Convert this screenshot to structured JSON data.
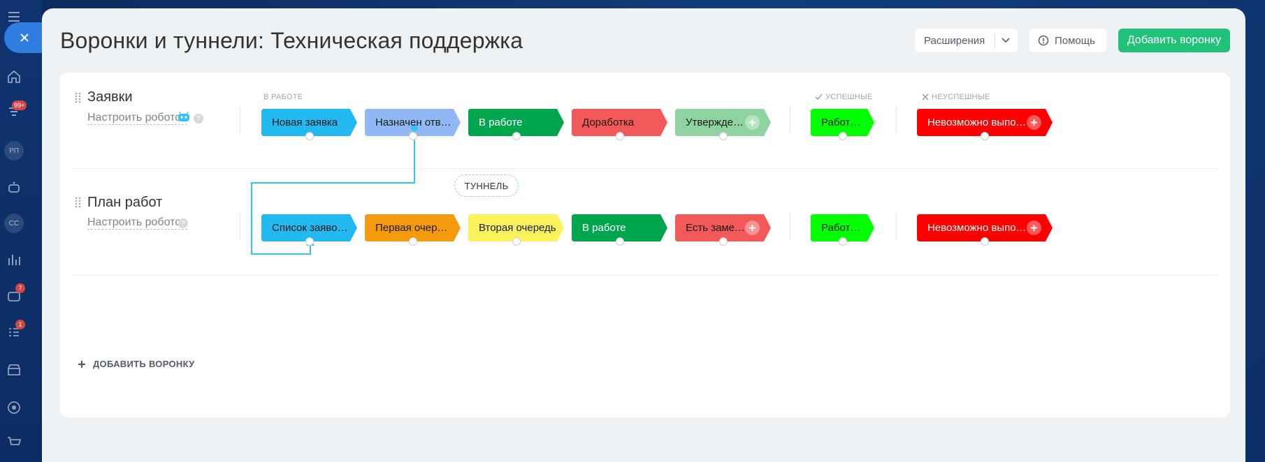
{
  "page": {
    "title": "Воронки и туннели: Техническая поддержка"
  },
  "header": {
    "extensions_label": "Расширения",
    "help_label": "Помощь",
    "add_funnel_label": "Добавить воронку"
  },
  "sidebar": {
    "badges": {
      "notifications": "99+",
      "chat": "7",
      "tasks": "1"
    },
    "avatars": [
      "РП",
      "СС"
    ]
  },
  "groups": {
    "in_progress": "В РАБОТЕ",
    "success": "УСПЕШНЫЕ",
    "fail": "НЕУСПЕШНЫЕ"
  },
  "funnels": [
    {
      "name": "Заявки",
      "robots_label": "Настроить роботов",
      "help": "?",
      "stages": [
        {
          "label": "Новая заявка",
          "color": "#22b8f0",
          "text_color": "#1a1a1a"
        },
        {
          "label": "Назначен отве...",
          "color": "#8fb8f5",
          "text_color": "#1a1a1a"
        },
        {
          "label": "В работе",
          "color": "#00a64d",
          "text_color": "#ffffff"
        },
        {
          "label": "Доработка",
          "color": "#f4595a",
          "text_color": "#1a1a1a"
        },
        {
          "label": "Утверждени...",
          "color": "#8fd4a0",
          "text_color": "#1a1a1a"
        }
      ],
      "success_stage": {
        "label": "Работы ...",
        "color": "#00ff00",
        "text_color": "#1a1a1a"
      },
      "fail_stage": {
        "label": "Невозможно выполн...",
        "color": "#ff0000",
        "text_color": "#ffffff"
      }
    },
    {
      "name": "План работ",
      "robots_label": "Настроить роботов",
      "help": "?",
      "stages": [
        {
          "label": "Список заявок...",
          "color": "#22b8f0",
          "text_color": "#1a1a1a"
        },
        {
          "label": "Первая очередь",
          "color": "#f59a0c",
          "text_color": "#1a1a1a"
        },
        {
          "label": "Вторая очередь",
          "color": "#fcf35c",
          "text_color": "#1a1a1a"
        },
        {
          "label": "В работе",
          "color": "#00a64d",
          "text_color": "#ffffff"
        },
        {
          "label": "Есть замеча...",
          "color": "#f4595a",
          "text_color": "#1a1a1a"
        }
      ],
      "success_stage": {
        "label": "Работы ...",
        "color": "#00ff00",
        "text_color": "#1a1a1a"
      },
      "fail_stage": {
        "label": "Невозможно выполн...",
        "color": "#ff0000",
        "text_color": "#ffffff"
      }
    }
  ],
  "tunnel": {
    "label": "ТУННЕЛЬ",
    "from_stage": "Назначен отве...",
    "to_stage": "Список заявок...",
    "color": "#2fc6f6"
  },
  "add_funnel_link": "ДОБАВИТЬ ВОРОНКУ"
}
